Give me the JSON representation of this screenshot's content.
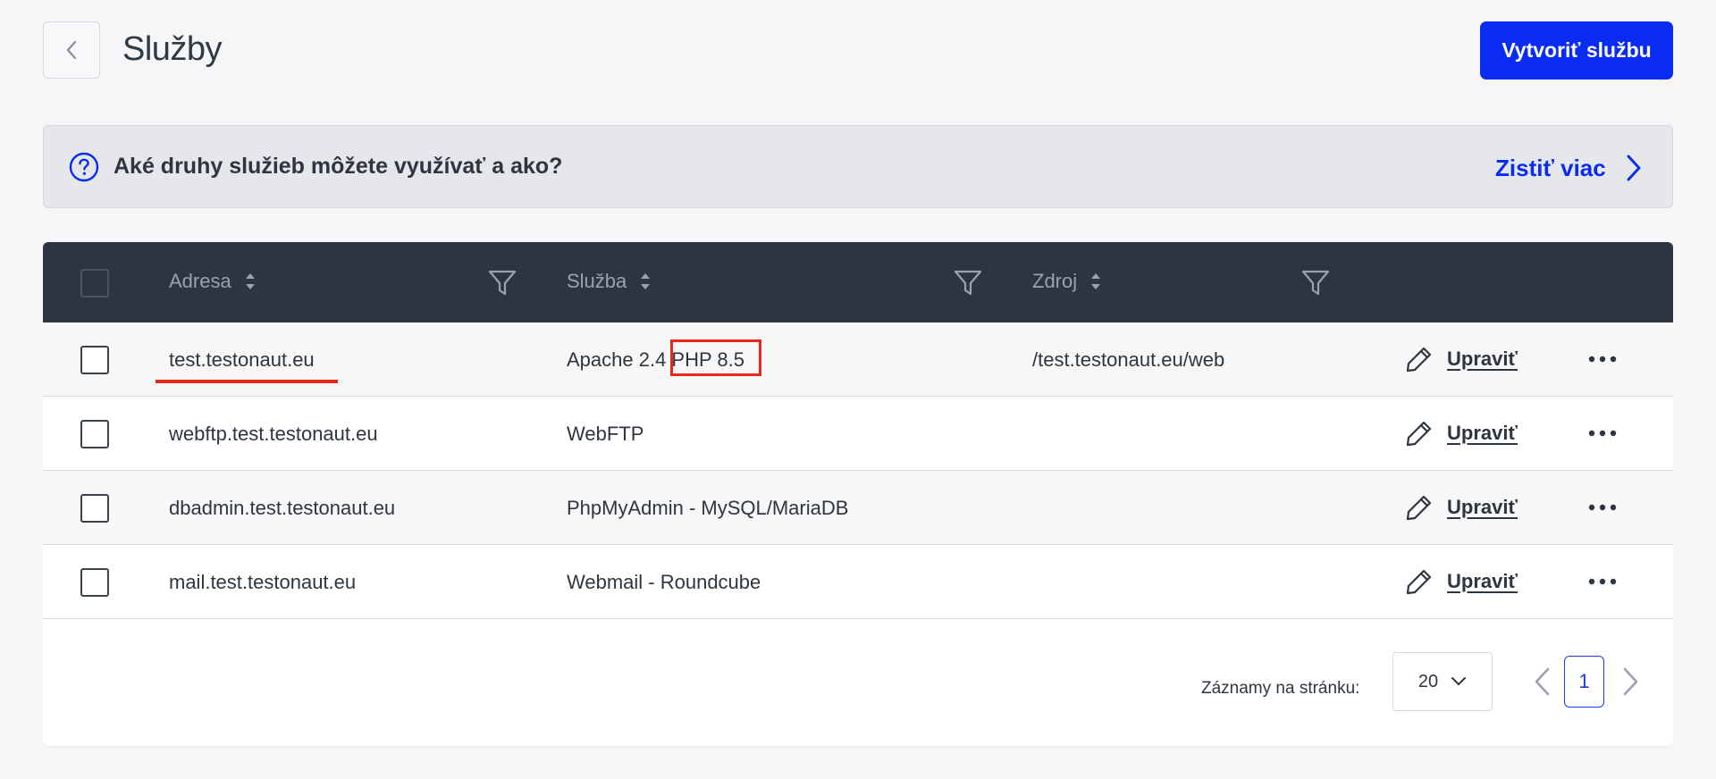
{
  "header": {
    "title": "Služby",
    "create_label": "Vytvoriť službu"
  },
  "banner": {
    "text": "Aké druhy služieb môžete využívať a ako?",
    "link_label": "Zistiť viac"
  },
  "table": {
    "columns": [
      "Adresa",
      "Služba",
      "Zdroj"
    ],
    "rows": [
      {
        "address": "test.testonaut.eu",
        "service": "Apache 2.4 PHP 8.5",
        "source": "/test.testonaut.eu/web",
        "action": "Upraviť"
      },
      {
        "address": "webftp.test.testonaut.eu",
        "service": "WebFTP",
        "source": "",
        "action": "Upraviť"
      },
      {
        "address": "dbadmin.test.testonaut.eu",
        "service": "PhpMyAdmin - MySQL/MariaDB",
        "source": "",
        "action": "Upraviť"
      },
      {
        "address": "mail.test.testonaut.eu",
        "service": "Webmail - Roundcube",
        "source": "",
        "action": "Upraviť"
      }
    ]
  },
  "pagination": {
    "per_page_label": "Záznamy na stránku:",
    "per_page_value": "20",
    "current_page": "1"
  },
  "colors": {
    "primary": "#0a2cf0",
    "table_header": "#2d3640",
    "annotation": "#e8281c"
  }
}
